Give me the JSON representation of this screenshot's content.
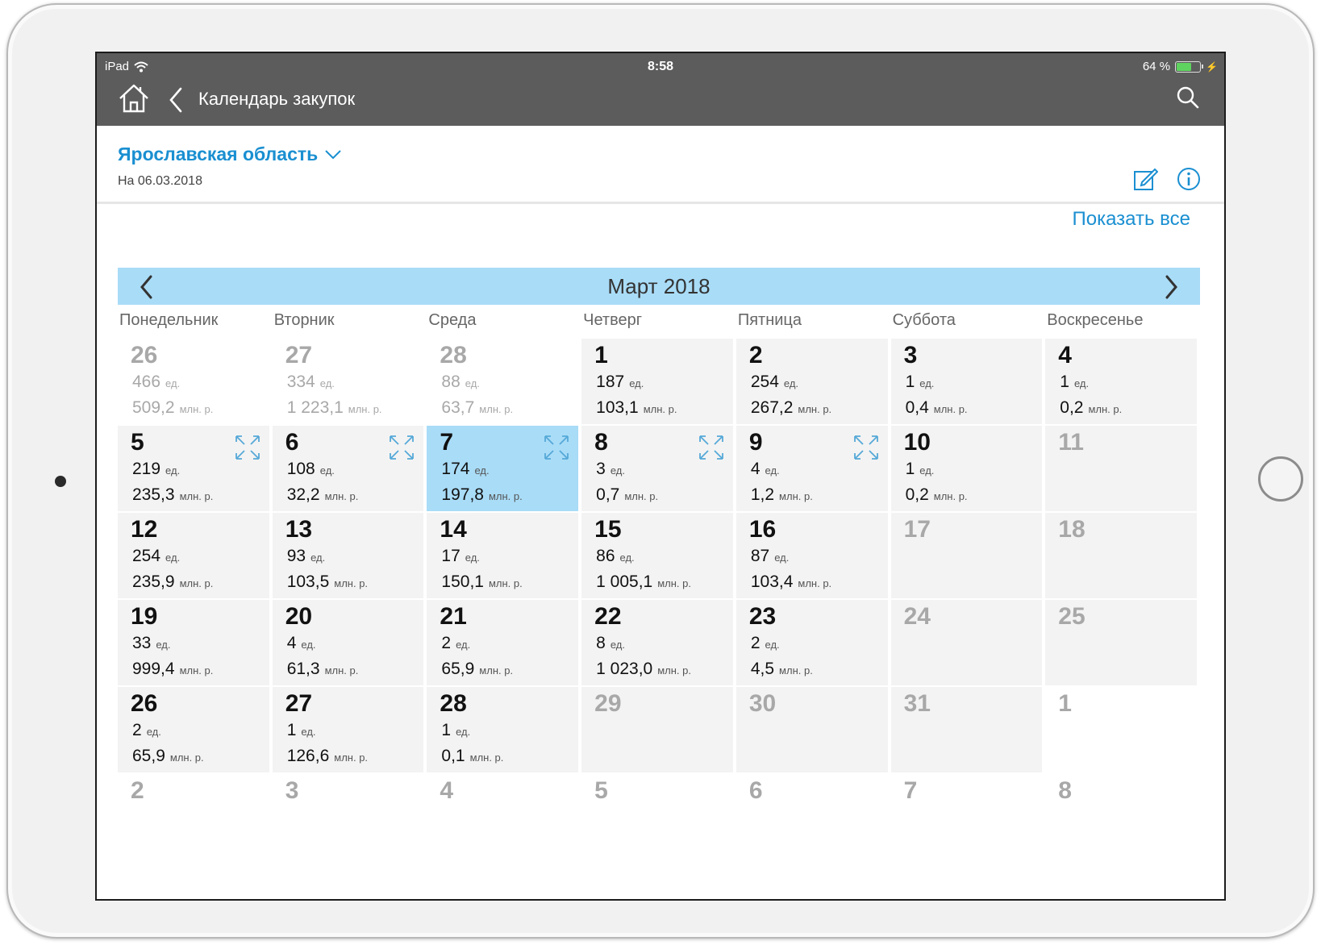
{
  "status_bar": {
    "device": "iPad",
    "time": "8:58",
    "battery": "64 %",
    "battery_level": 0.64
  },
  "navbar": {
    "title": "Календарь закупок"
  },
  "header": {
    "region": "Ярославская область",
    "as_of": "На 06.03.2018",
    "show_all": "Показать все"
  },
  "calendar": {
    "month_title": "Март 2018",
    "weekdays": [
      "Понедельник",
      "Вторник",
      "Среда",
      "Четверг",
      "Пятница",
      "Суббота",
      "Воскресенье"
    ],
    "unit_count": "ед.",
    "unit_money": "млн. р.",
    "selected_day": "7",
    "weeks": [
      [
        {
          "day": "26",
          "count": "466",
          "sum": "509,2",
          "outside": true
        },
        {
          "day": "27",
          "count": "334",
          "sum": "1 223,1",
          "outside": true
        },
        {
          "day": "28",
          "count": "88",
          "sum": "63,7",
          "outside": true
        },
        {
          "day": "1",
          "count": "187",
          "sum": "103,1"
        },
        {
          "day": "2",
          "count": "254",
          "sum": "267,2"
        },
        {
          "day": "3",
          "count": "1",
          "sum": "0,4"
        },
        {
          "day": "4",
          "count": "1",
          "sum": "0,2"
        }
      ],
      [
        {
          "day": "5",
          "count": "219",
          "sum": "235,3",
          "expand": true
        },
        {
          "day": "6",
          "count": "108",
          "sum": "32,2",
          "expand": true
        },
        {
          "day": "7",
          "count": "174",
          "sum": "197,8",
          "expand": true,
          "selected": true
        },
        {
          "day": "8",
          "count": "3",
          "sum": "0,7",
          "expand": true
        },
        {
          "day": "9",
          "count": "4",
          "sum": "1,2",
          "expand": true
        },
        {
          "day": "10",
          "count": "1",
          "sum": "0,2"
        },
        {
          "day": "11",
          "empty": true
        }
      ],
      [
        {
          "day": "12",
          "count": "254",
          "sum": "235,9"
        },
        {
          "day": "13",
          "count": "93",
          "sum": "103,5"
        },
        {
          "day": "14",
          "count": "17",
          "sum": "150,1"
        },
        {
          "day": "15",
          "count": "86",
          "sum": "1 005,1"
        },
        {
          "day": "16",
          "count": "87",
          "sum": "103,4"
        },
        {
          "day": "17",
          "empty": true
        },
        {
          "day": "18",
          "empty": true
        }
      ],
      [
        {
          "day": "19",
          "count": "33",
          "sum": "999,4"
        },
        {
          "day": "20",
          "count": "4",
          "sum": "61,3"
        },
        {
          "day": "21",
          "count": "2",
          "sum": "65,9"
        },
        {
          "day": "22",
          "count": "8",
          "sum": "1 023,0"
        },
        {
          "day": "23",
          "count": "2",
          "sum": "4,5"
        },
        {
          "day": "24",
          "empty": true
        },
        {
          "day": "25",
          "empty": true
        }
      ],
      [
        {
          "day": "26",
          "count": "2",
          "sum": "65,9"
        },
        {
          "day": "27",
          "count": "1",
          "sum": "126,6"
        },
        {
          "day": "28",
          "count": "1",
          "sum": "0,1"
        },
        {
          "day": "29",
          "empty": true
        },
        {
          "day": "30",
          "empty": true
        },
        {
          "day": "31",
          "empty": true
        },
        {
          "day": "1",
          "empty": true,
          "outside": true
        }
      ],
      [
        {
          "day": "2",
          "empty": true,
          "outside": true
        },
        {
          "day": "3",
          "empty": true,
          "outside": true
        },
        {
          "day": "4",
          "empty": true,
          "outside": true
        },
        {
          "day": "5",
          "empty": true,
          "outside": true
        },
        {
          "day": "6",
          "empty": true,
          "outside": true
        },
        {
          "day": "7",
          "empty": true,
          "outside": true
        },
        {
          "day": "8",
          "empty": true,
          "outside": true
        }
      ]
    ]
  },
  "colors": {
    "accent": "#1a8fd1",
    "month_bar": "#a9dcf7",
    "topbar": "#5c5c5c",
    "cell_bg": "#f3f3f3",
    "dim_text": "#a8a8a8"
  },
  "icons": {
    "home": "home-icon",
    "back": "chevron-left-icon",
    "search": "search-icon",
    "dropdown": "chevron-down-icon",
    "edit": "edit-icon",
    "info": "info-icon",
    "prev_month": "chevron-left-icon",
    "next_month": "chevron-right-icon",
    "expand": "expand-icon",
    "wifi": "wifi-icon",
    "battery": "battery-icon"
  }
}
